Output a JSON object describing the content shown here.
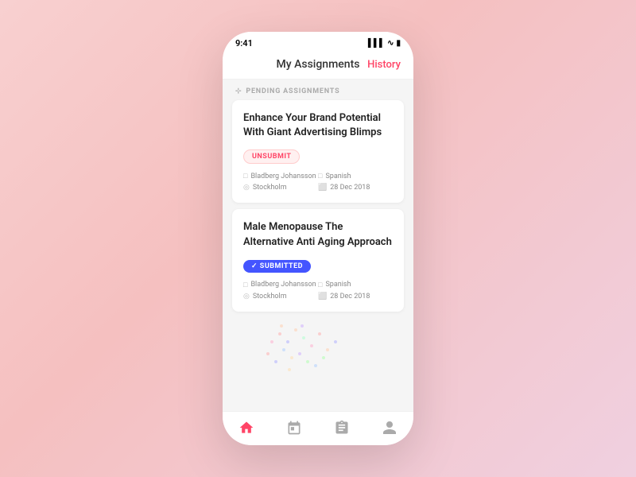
{
  "statusBar": {
    "time": "9:41",
    "signal": "▌▌▌",
    "wifi": "WiFi",
    "battery": "🔋"
  },
  "header": {
    "title": "My Assignments",
    "historyLabel": "History"
  },
  "sectionLabel": "PENDING ASSIGNMENTS",
  "cards": [
    {
      "title": "Enhance Your Brand Potential With Giant Advertising Blimps",
      "badgeType": "unsubmit",
      "badgeLabel": "UNSUBMIT",
      "author": "Bladberg Johansson",
      "location": "Stockholm",
      "language": "Spanish",
      "date": "28 Dec 2018"
    },
    {
      "title": "Male Menopause The Alternative Anti Aging Approach",
      "badgeType": "submitted",
      "badgeLabel": "SUBMITTED",
      "author": "Bladberg Johansson",
      "location": "Stockholm",
      "language": "Spanish",
      "date": "28 Dec 2018"
    }
  ],
  "nav": [
    {
      "icon": "🏠",
      "label": "home",
      "active": true
    },
    {
      "icon": "📅",
      "label": "calendar",
      "active": false
    },
    {
      "icon": "📋",
      "label": "clipboard",
      "active": false
    },
    {
      "icon": "👤",
      "label": "profile",
      "active": false
    }
  ],
  "colors": {
    "accent": "#ff4466",
    "submitted": "#4455ff"
  }
}
